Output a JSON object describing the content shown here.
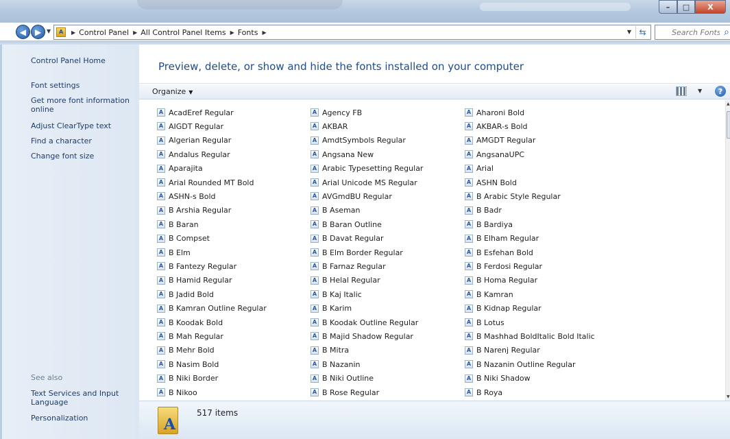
{
  "window": {
    "controls": {
      "minimize": "–",
      "maximize": "□",
      "close": "X"
    }
  },
  "nav": {
    "back_icon": "arrow-left-icon",
    "forward_icon": "arrow-right-icon",
    "breadcrumbs": [
      "Control Panel",
      "All Control Panel Items",
      "Fonts"
    ],
    "search_placeholder": "Search Fonts"
  },
  "sidebar": {
    "home": "Control Panel Home",
    "links": [
      "Font settings",
      "Get more font information online",
      "Adjust ClearType text",
      "Find a character",
      "Change font size"
    ],
    "see_also_label": "See also",
    "see_also_links": [
      "Text Services and Input Language",
      "Personalization"
    ]
  },
  "header": {
    "title": "Preview, delete, or show and hide the fonts installed on your computer"
  },
  "toolbar": {
    "organize": "Organize"
  },
  "fonts": {
    "columns": [
      [
        "AcadEref Regular",
        "AIGDT Regular",
        "Algerian Regular",
        "Andalus Regular",
        "Aparajita",
        "Arial Rounded MT Bold",
        "ASHN-s Bold",
        "B Arshia Regular",
        "B Baran",
        "B Compset",
        "B Elm",
        "B Fantezy Regular",
        "B Hamid Regular",
        "B Jadid Bold",
        "B Kamran Outline Regular",
        "B Koodak Bold",
        "B Mah Regular",
        "B Mehr Bold",
        "B Nasim Bold",
        "B Niki Border",
        "B Nikoo"
      ],
      [
        "Agency FB",
        "AKBAR",
        "AmdtSymbols Regular",
        "Angsana New",
        "Arabic Typesetting Regular",
        "Arial Unicode MS Regular",
        "AVGmdBU Regular",
        "B Aseman",
        "B Baran Outline",
        "B Davat Regular",
        "B Elm Border Regular",
        "B Farnaz Regular",
        "B Helal Regular",
        "B Kaj Italic",
        "B Karim",
        "B Koodak Outline Regular",
        "B Majid Shadow Regular",
        "B Mitra",
        "B Nazanin",
        "B Niki Outline",
        "B Rose Regular"
      ],
      [
        "Aharoni Bold",
        "AKBAR-s Bold",
        "AMGDT Regular",
        "AngsanaUPC",
        "Arial",
        "ASHN Bold",
        "B Arabic Style Regular",
        "B Badr",
        "B Bardiya",
        "B Elham Regular",
        "B Esfehan Bold",
        "B Ferdosi Regular",
        "B Homa Regular",
        "B Kamran",
        "B Kidnap Regular",
        "B Lotus",
        "B Mashhad BoldItalic Bold Italic",
        "B Narenj Regular",
        "B Nazanin Outline Regular",
        "B Niki Shadow",
        "B Roya"
      ]
    ]
  },
  "status": {
    "count": "517 items"
  }
}
